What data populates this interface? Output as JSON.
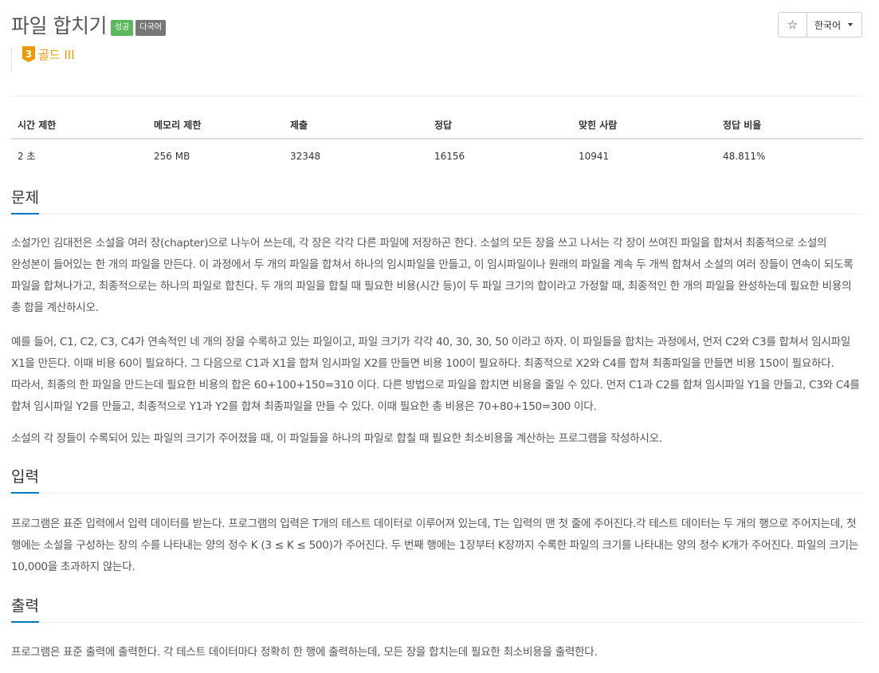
{
  "header": {
    "title": "파일 합치기",
    "badges": {
      "success": "성공",
      "multilang": "다국어"
    },
    "star": "☆",
    "language": "한국어"
  },
  "tier": {
    "level": "3",
    "label": "골드 III",
    "color": "#ec9a00"
  },
  "info_table": {
    "headers": [
      "시간 제한",
      "메모리 제한",
      "제출",
      "정답",
      "맞힌 사람",
      "정답 비율"
    ],
    "values": [
      "2 초",
      "256 MB",
      "32348",
      "16156",
      "10941",
      "48.811%"
    ]
  },
  "sections": {
    "problem": {
      "heading": "문제",
      "paragraphs": [
        "소설가인 김대전은 소설을 여러 장(chapter)으로 나누어 쓰는데, 각 장은 각각 다른 파일에 저장하곤 한다. 소설의 모든 장을 쓰고 나서는 각 장이 쓰여진 파일을 합쳐서 최종적으로 소설의 완성본이 들어있는 한 개의 파일을 만든다. 이 과정에서 두 개의 파일을 합쳐서 하나의 임시파일을 만들고, 이 임시파일이나 원래의 파일을 계속 두 개씩 합쳐서 소설의 여러 장들이 연속이 되도록 파일을 합쳐나가고, 최종적으로는 하나의 파일로 합친다. 두 개의 파일을 합칠 때 필요한 비용(시간 등)이 두 파일 크기의 합이라고 가정할 때, 최종적인 한 개의 파일을 완성하는데 필요한 비용의 총 합을 계산하시오.",
        "예를 들어, C1, C2, C3, C4가 연속적인 네 개의 장을 수록하고 있는 파일이고, 파일 크기가 각각 40, 30, 30, 50 이라고 하자. 이 파일들을 합치는 과정에서, 먼저 C2와 C3를 합쳐서 임시파일 X1을 만든다. 이때 비용 60이 필요하다. 그 다음으로 C1과 X1을 합쳐 임시파일 X2를 만들면 비용 100이 필요하다. 최종적으로 X2와 C4를 합쳐 최종파일을 만들면 비용 150이 필요하다. 따라서, 최종의 한 파일을 만드는데 필요한 비용의 합은 60+100+150=310 이다. 다른 방법으로 파일을 합치면 비용을 줄일 수 있다. 먼저 C1과 C2를 합쳐 임시파일 Y1을 만들고, C3와 C4를 합쳐 임시파일 Y2를 만들고, 최종적으로 Y1과 Y2를 합쳐 최종파일을 만들 수 있다. 이때 필요한 총 비용은 70+80+150=300 이다.",
        "소설의 각 장들이 수록되어 있는 파일의 크기가 주어졌을 때, 이 파일들을 하나의 파일로 합칠 때 필요한 최소비용을 계산하는 프로그램을 작성하시오."
      ]
    },
    "input": {
      "heading": "입력",
      "paragraphs": [
        "프로그램은 표준 입력에서 입력 데이터를 받는다. 프로그램의 입력은 T개의 테스트 데이터로 이루어져 있는데, T는 입력의 맨 첫 줄에 주어진다.각 테스트 데이터는 두 개의 행으로 주어지는데, 첫 행에는 소설을 구성하는 장의 수를 나타내는 양의 정수 K (3 ≤ K ≤ 500)가 주어진다. 두 번째 행에는 1장부터 K장까지 수록한 파일의 크기를 나타내는 양의 정수 K개가 주어진다. 파일의 크기는 10,000을 초과하지 않는다."
      ]
    },
    "output": {
      "heading": "출력",
      "paragraphs": [
        "프로그램은 표준 출력에 출력한다. 각 테스트 데이터마다 정확히 한 행에 출력하는데, 모든 장을 합치는데 필요한 최소비용을 출력한다."
      ]
    }
  },
  "colors": {
    "accent": "#0076c0",
    "success": "#5cb85c",
    "gold": "#ec9a00"
  }
}
